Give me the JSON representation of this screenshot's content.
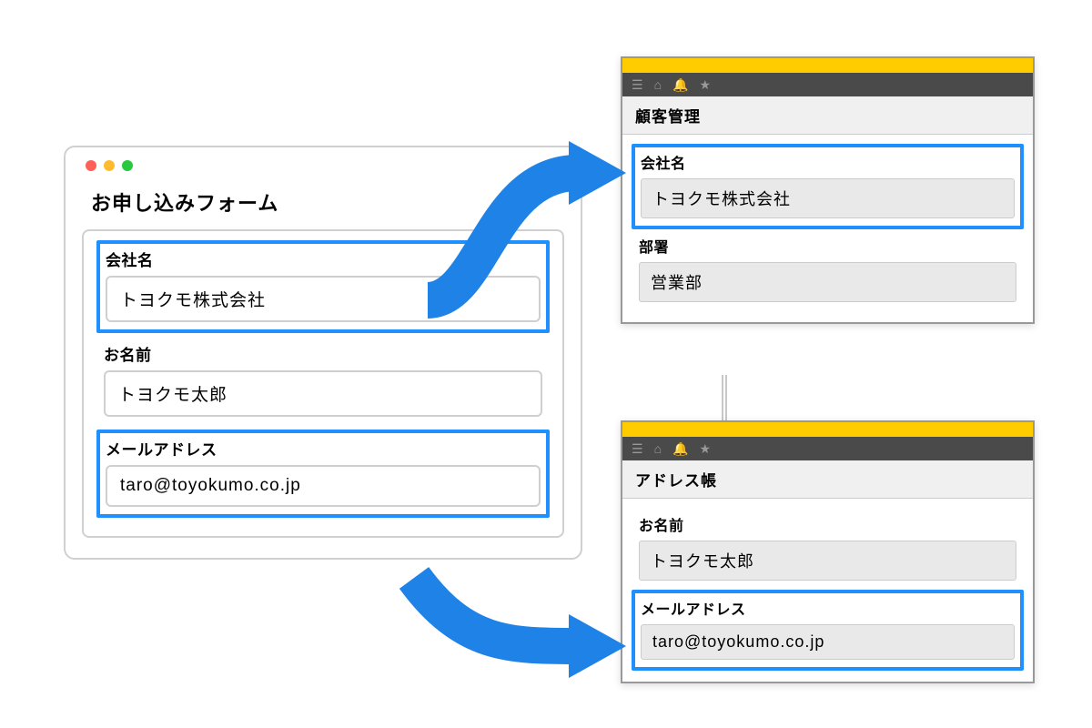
{
  "form": {
    "title": "お申し込みフォーム",
    "fields": {
      "company": {
        "label": "会社名",
        "value": "トヨクモ株式会社"
      },
      "name": {
        "label": "お名前",
        "value": "トヨクモ太郎"
      },
      "email": {
        "label": "メールアドレス",
        "value": "taro@toyokumo.co.jp"
      }
    }
  },
  "apps": {
    "customer": {
      "title": "顧客管理",
      "fields": {
        "company": {
          "label": "会社名",
          "value": "トヨクモ株式会社"
        },
        "department": {
          "label": "部署",
          "value": "営業部"
        }
      }
    },
    "address": {
      "title": "アドレス帳",
      "fields": {
        "name": {
          "label": "お名前",
          "value": "トヨクモ太郎"
        },
        "email": {
          "label": "メールアドレス",
          "value": "taro@toyokumo.co.jp"
        }
      }
    }
  },
  "colors": {
    "highlight": "#1e90ff",
    "accent": "#ffcc00"
  }
}
